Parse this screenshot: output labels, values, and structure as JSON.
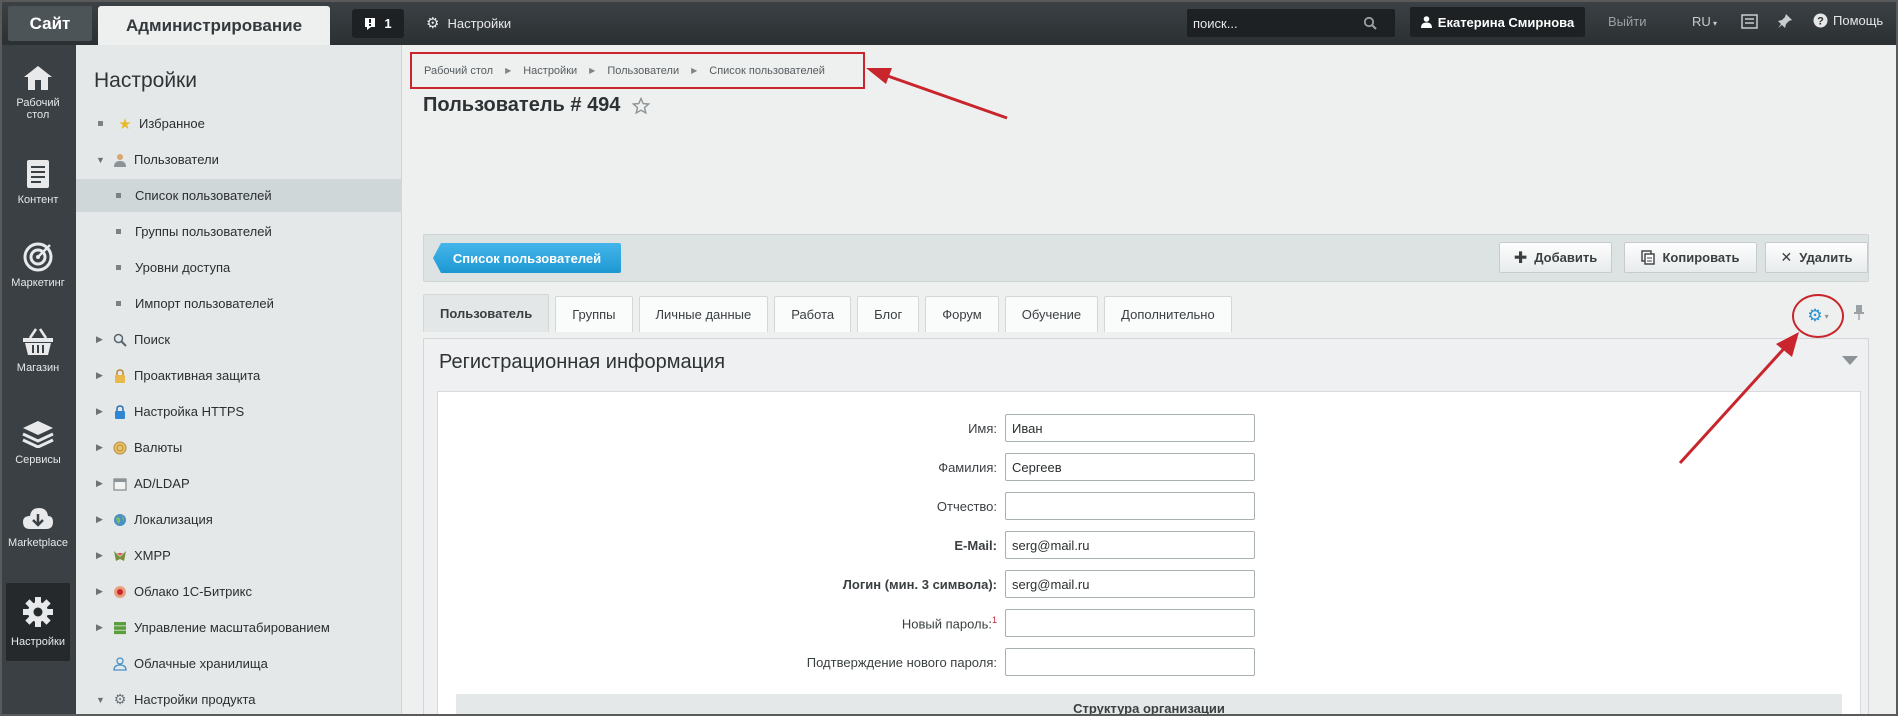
{
  "topbar": {
    "site_label": "Сайт",
    "admin_label": "Администрирование",
    "notifications_count": "1",
    "settings_label": "Настройки",
    "search_placeholder": "поиск...",
    "user_name": "Екатерина Смирнова",
    "logout_label": "Выйти",
    "language": "RU",
    "help_label": "Помощь"
  },
  "iconbar": {
    "items": [
      {
        "label_line1": "Рабочий",
        "label_line2": "стол",
        "icon": "home-icon"
      },
      {
        "label_line1": "Контент",
        "label_line2": "",
        "icon": "document-icon"
      },
      {
        "label_line1": "Маркетинг",
        "label_line2": "",
        "icon": "target-icon"
      },
      {
        "label_line1": "Магазин",
        "label_line2": "",
        "icon": "basket-icon"
      },
      {
        "label_line1": "Сервисы",
        "label_line2": "",
        "icon": "layers-icon"
      },
      {
        "label_line1": "Marketplace",
        "label_line2": "",
        "icon": "cloud-download-icon"
      },
      {
        "label_line1": "Настройки",
        "label_line2": "",
        "icon": "gear-icon"
      }
    ]
  },
  "menu": {
    "title": "Настройки",
    "items": [
      {
        "label": "Избранное"
      },
      {
        "label": "Пользователи"
      },
      {
        "label": "Список пользователей"
      },
      {
        "label": "Группы пользователей"
      },
      {
        "label": "Уровни доступа"
      },
      {
        "label": "Импорт пользователей"
      },
      {
        "label": "Поиск"
      },
      {
        "label": "Проактивная защита"
      },
      {
        "label": "Настройка HTTPS"
      },
      {
        "label": "Валюты"
      },
      {
        "label": "AD/LDAP"
      },
      {
        "label": "Локализация"
      },
      {
        "label": "XMPP"
      },
      {
        "label": "Облако 1С-Битрикс"
      },
      {
        "label": "Управление масштабированием"
      },
      {
        "label": "Облачные хранилища"
      },
      {
        "label": "Настройки продукта"
      }
    ]
  },
  "breadcrumb": [
    "Рабочий стол",
    "Настройки",
    "Пользователи",
    "Список пользователей"
  ],
  "page": {
    "title": "Пользователь # 494"
  },
  "toolbar": {
    "list_label": "Список пользователей",
    "add_label": "Добавить",
    "copy_label": "Копировать",
    "delete_label": "Удалить"
  },
  "tabs": [
    "Пользователь",
    "Группы",
    "Личные данные",
    "Работа",
    "Блог",
    "Форум",
    "Обучение",
    "Дополнительно"
  ],
  "section": {
    "title": "Регистрационная информация",
    "structure_label": "Структура организации"
  },
  "form": {
    "first_name_label": "Имя:",
    "first_name_value": "Иван",
    "last_name_label": "Фамилия:",
    "last_name_value": "Сергеев",
    "middle_name_label": "Отчество:",
    "middle_name_value": "",
    "email_label": "E-Mail:",
    "email_value": "serg@mail.ru",
    "login_label": "Логин (мин. 3 символа):",
    "login_value": "serg@mail.ru",
    "new_password_label": "Новый пароль:",
    "new_password_note": "1",
    "new_password_value": "",
    "confirm_password_label": "Подтверждение нового пароля:",
    "confirm_password_value": ""
  },
  "colors": {
    "accent_blue": "#1d97d2",
    "annotation_red": "#c8262c"
  }
}
